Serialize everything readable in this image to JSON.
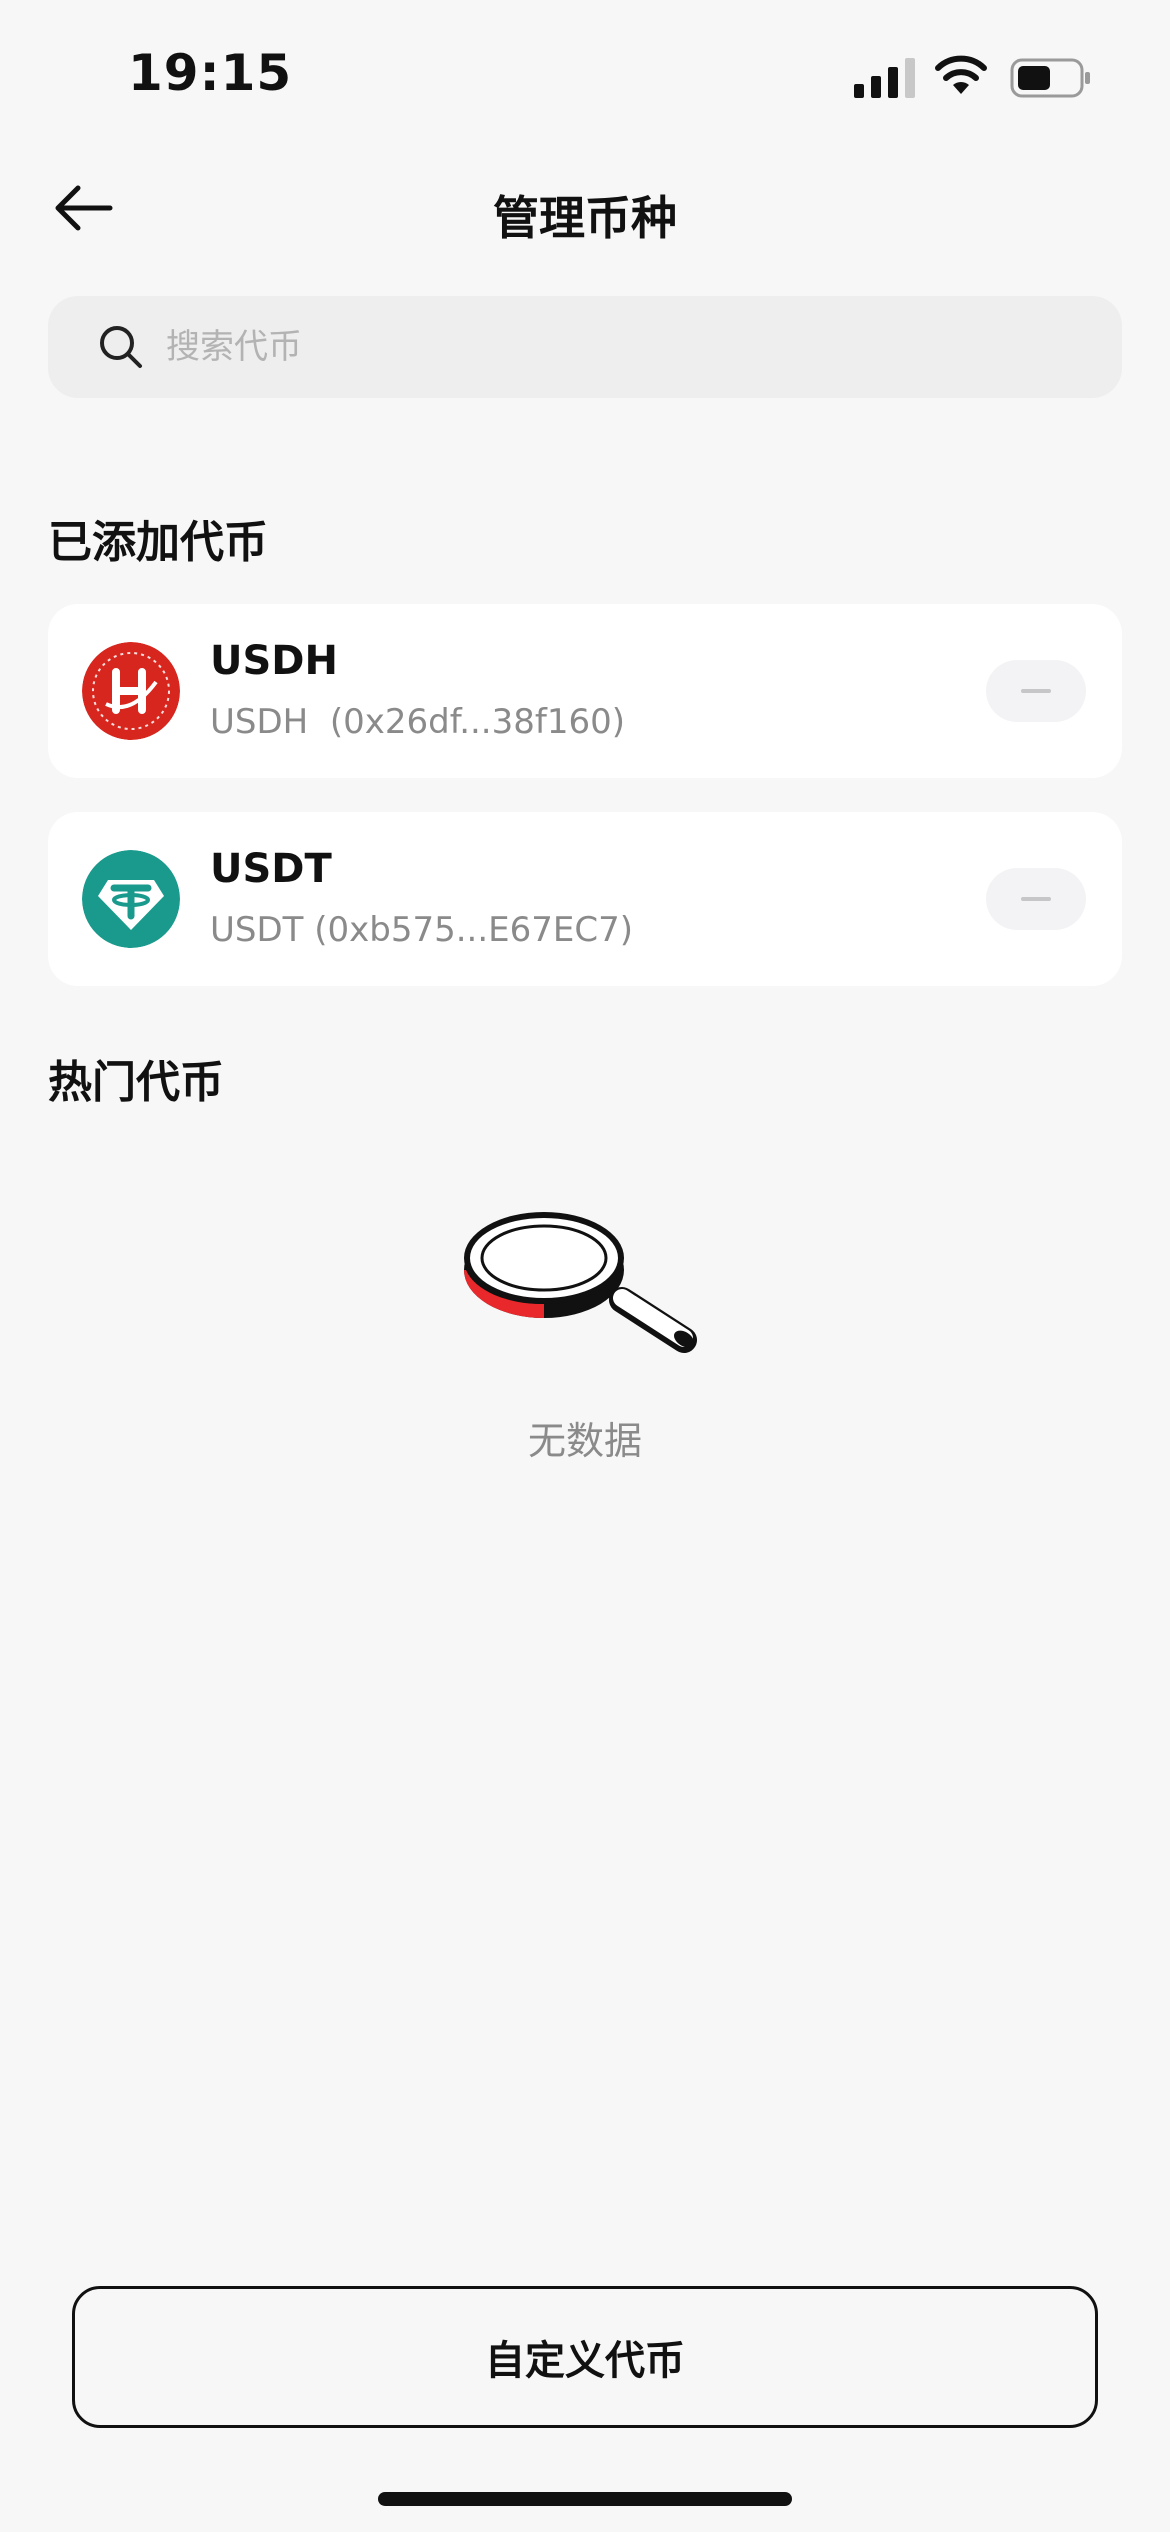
{
  "status_bar": {
    "time": "19:15"
  },
  "header": {
    "title": "管理币种",
    "back_icon": "arrow-left-icon"
  },
  "search": {
    "placeholder": "搜索代币",
    "value": "",
    "icon": "search-icon"
  },
  "added_section": {
    "title": "已添加代币",
    "tokens": [
      {
        "name": "USDH",
        "detail": "USDH  (0x26df...38f160)",
        "logo_color": "#d7261e"
      },
      {
        "name": "USDT",
        "detail": "USDT (0xb575...E67EC7)",
        "logo_color": "#1a9a8d"
      }
    ]
  },
  "hot_section": {
    "title": "热门代币",
    "empty_text": "无数据"
  },
  "footer": {
    "custom_button": "自定义代币"
  },
  "colors": {
    "background": "#f7f7f7",
    "card": "#ffffff",
    "search_bg": "#eeeeee",
    "accent_red": "#e8282b"
  }
}
